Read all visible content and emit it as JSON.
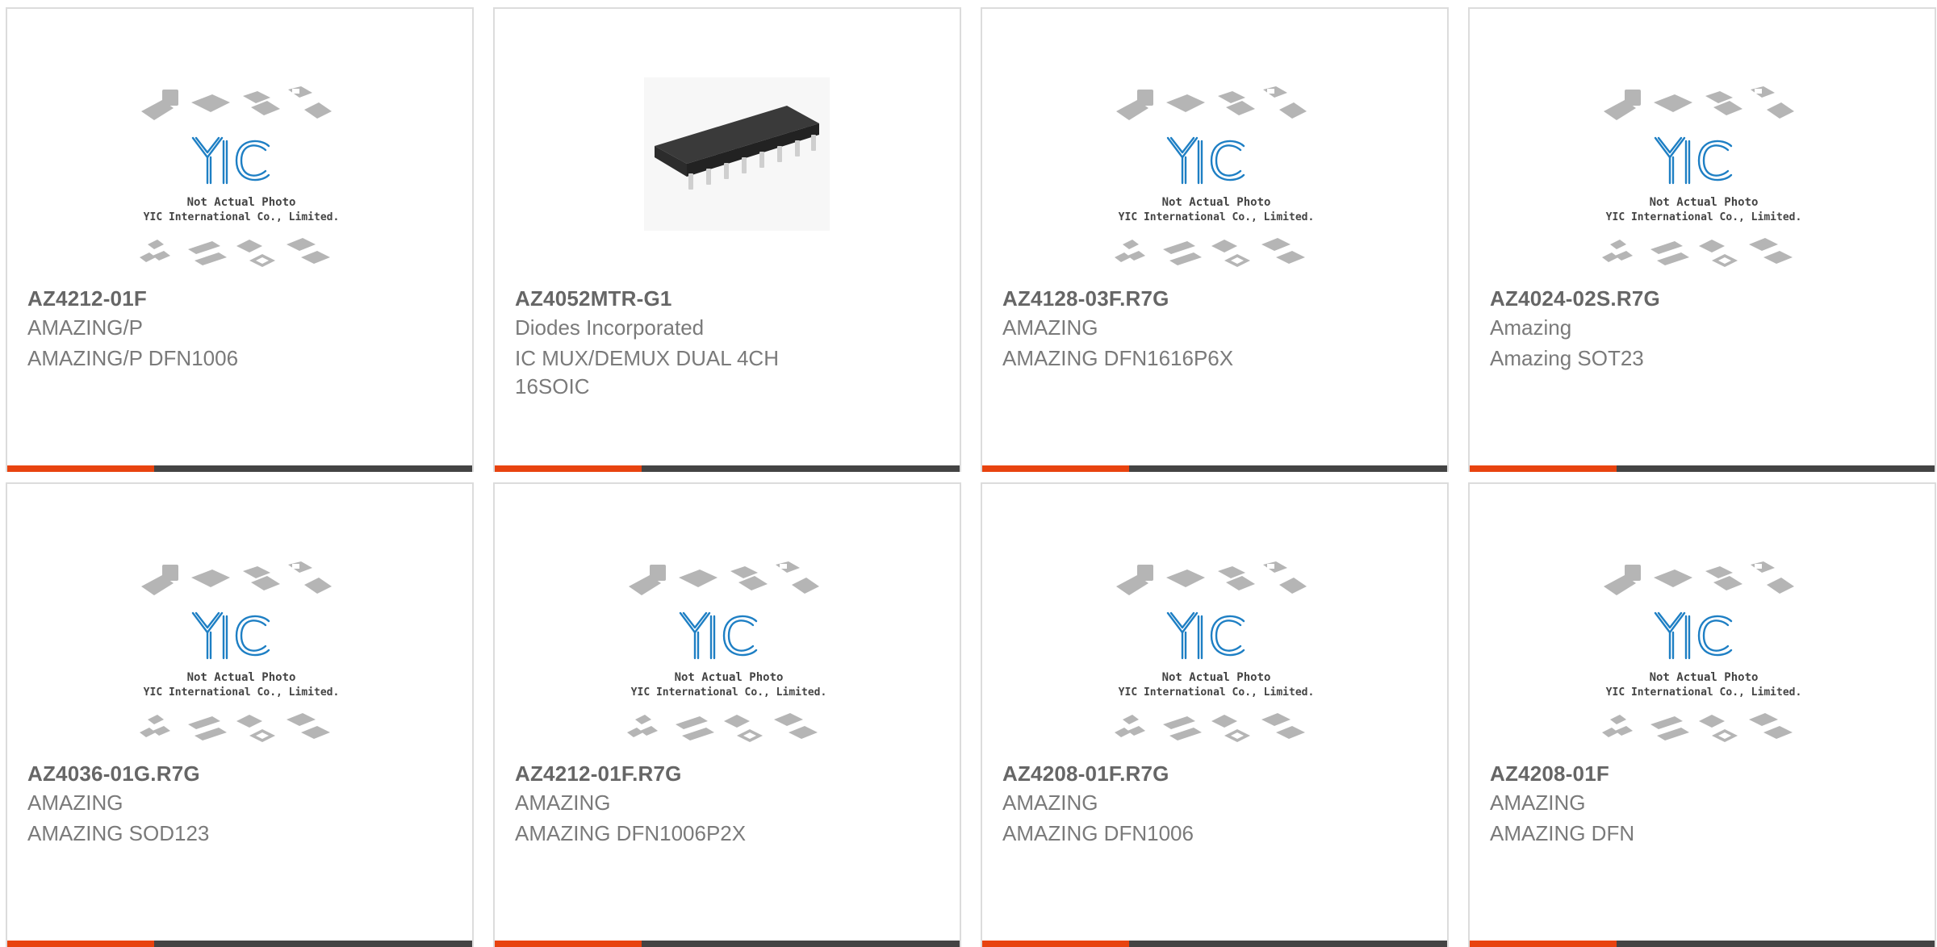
{
  "products": [
    {
      "part_number": "AZ4212-01F",
      "manufacturer": "AMAZING/P",
      "description": "AMAZING/P DFN1006",
      "image": "not-actual-photo",
      "placeholder_line1": "Not Actual Photo",
      "placeholder_line2": "YIC International Co., Limited."
    },
    {
      "part_number": "AZ4052MTR-G1",
      "manufacturer": "Diodes Incorporated",
      "description": "IC MUX/DEMUX DUAL 4CH 16SOIC",
      "image": "soic-chip-photo"
    },
    {
      "part_number": "AZ4128-03F.R7G",
      "manufacturer": "AMAZING",
      "description": "AMAZING DFN1616P6X",
      "image": "not-actual-photo",
      "placeholder_line1": "Not Actual Photo",
      "placeholder_line2": "YIC International Co., Limited."
    },
    {
      "part_number": "AZ4024-02S.R7G",
      "manufacturer": "Amazing",
      "description": "Amazing SOT23",
      "image": "not-actual-photo",
      "placeholder_line1": "Not Actual Photo",
      "placeholder_line2": "YIC International Co., Limited."
    },
    {
      "part_number": "AZ4036-01G.R7G",
      "manufacturer": "AMAZING",
      "description": "AMAZING SOD123",
      "image": "not-actual-photo",
      "placeholder_line1": "Not Actual Photo",
      "placeholder_line2": "YIC International Co., Limited."
    },
    {
      "part_number": "AZ4212-01F.R7G",
      "manufacturer": "AMAZING",
      "description": "AMAZING DFN1006P2X",
      "image": "not-actual-photo",
      "placeholder_line1": "Not Actual Photo",
      "placeholder_line2": "YIC International Co., Limited."
    },
    {
      "part_number": "AZ4208-01F.R7G",
      "manufacturer": "AMAZING",
      "description": "AMAZING DFN1006",
      "image": "not-actual-photo",
      "placeholder_line1": "Not Actual Photo",
      "placeholder_line2": "YIC International Co., Limited."
    },
    {
      "part_number": "AZ4208-01F",
      "manufacturer": "AMAZING",
      "description": "AMAZING DFN",
      "image": "not-actual-photo",
      "placeholder_line1": "Not Actual Photo",
      "placeholder_line2": "YIC International Co., Limited."
    }
  ],
  "placeholder_logo": "YIC",
  "colors": {
    "accent": "#e8430f",
    "bar": "#444444",
    "logo_blue": "#1e7fc4",
    "part_text": "#666666",
    "meta_text": "#7a7a7a",
    "border": "#dcdcdc"
  }
}
